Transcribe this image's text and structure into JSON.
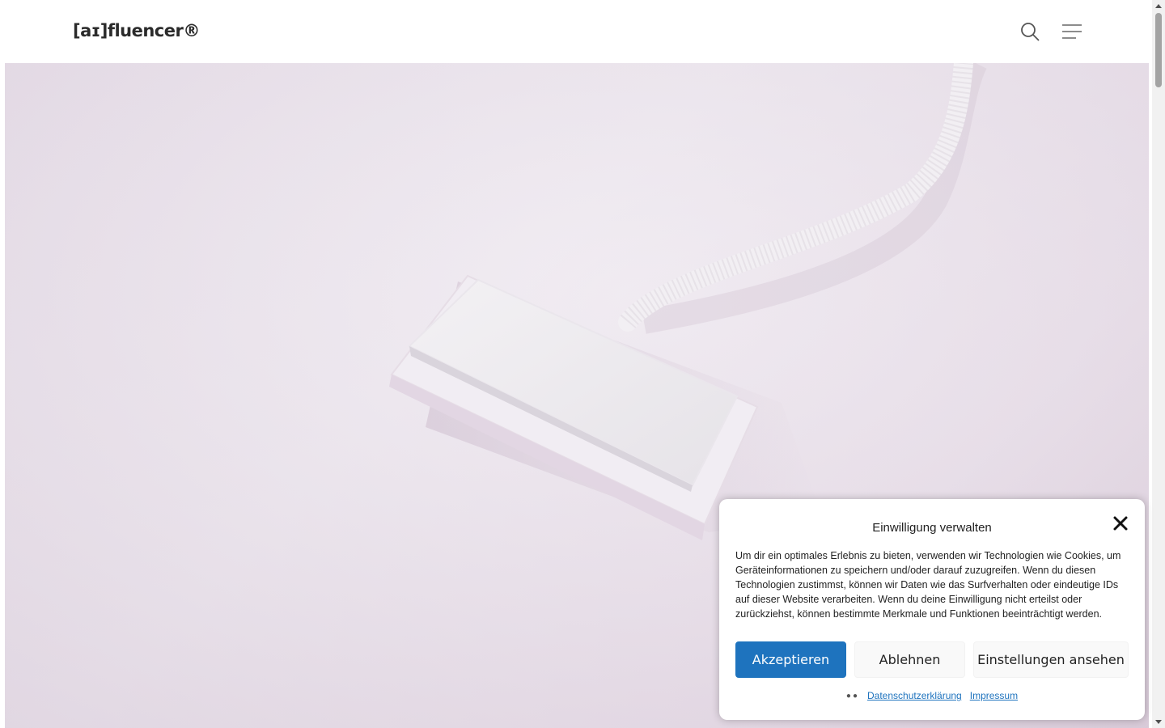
{
  "header": {
    "logo": "[aɪ]fluencer®",
    "icons": [
      "search-icon",
      "menu-icon"
    ]
  },
  "hero": {
    "image": "white-keycap-with-cable-on-pink-surface"
  },
  "consent": {
    "title": "Einwilligung verwalten",
    "text": "Um dir ein optimales Erlebnis zu bieten, verwenden wir Technologien wie Cookies, um Geräteinformationen zu speichern und/oder darauf zuzugreifen. Wenn du diesen Technologien zustimmst, können wir Daten wie das Surfverhalten oder eindeutige IDs auf dieser Website verarbeiten. Wenn du deine Einwilligung nicht erteilst oder zurückziehst, können bestimmte Merkmale und Funktionen beeinträchtigt werden.",
    "accept_label": "Akzeptieren",
    "deny_label": "Ablehnen",
    "settings_label": "Einstellungen ansehen",
    "privacy_link": "Datenschutzerklärung",
    "imprint_link": "Impressum"
  },
  "colors": {
    "accent": "#1e73be",
    "hero_bg": "#e9e2eb"
  }
}
